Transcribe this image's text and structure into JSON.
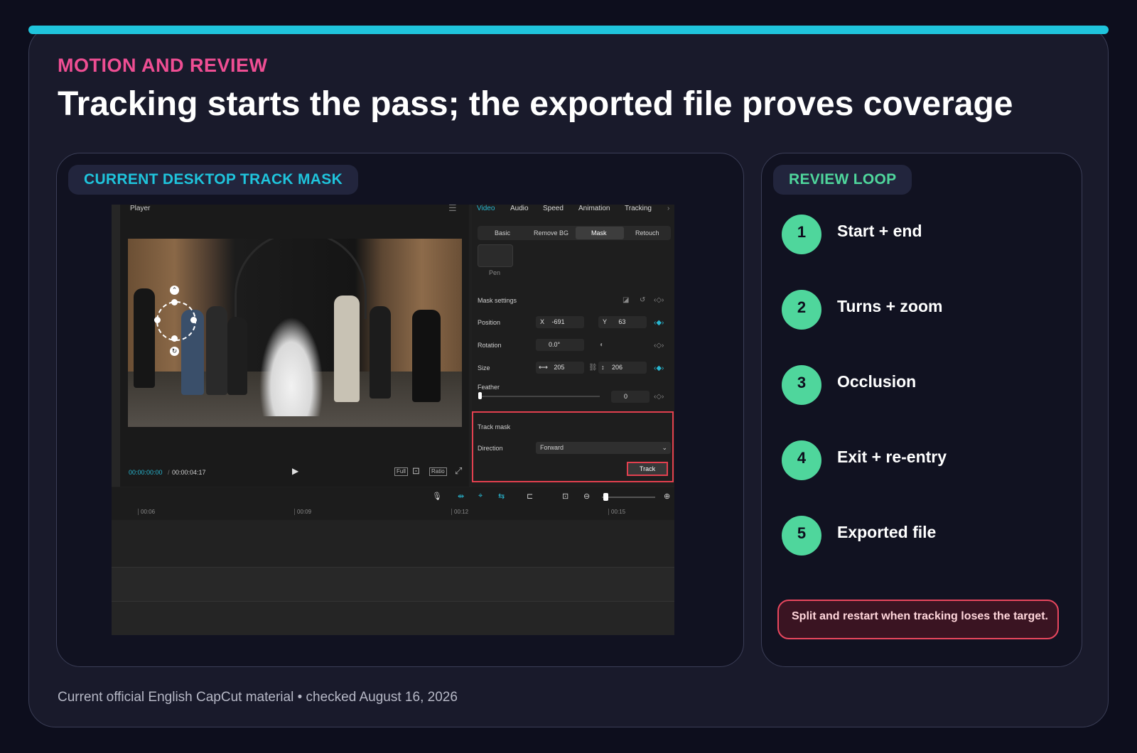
{
  "slide": {
    "eyebrow": "MOTION AND REVIEW",
    "title": "Tracking starts the pass; the exported file proves coverage",
    "footer": "Current official English CapCut material • checked August 16, 2026",
    "accent_color": "#1fc4dc",
    "eyebrow_color": "#ef4e93",
    "step_color": "#4fd69c",
    "warning_color": "#e8475e"
  },
  "left_card": {
    "label": "CURRENT DESKTOP TRACK MASK"
  },
  "capcut": {
    "player": {
      "title": "Player",
      "current_time": "00:00:00:00",
      "separator": "/",
      "total_time": "00:00:04:17",
      "controls": [
        "Full",
        "Ratio"
      ]
    },
    "panel": {
      "tabs": [
        "Video",
        "Audio",
        "Speed",
        "Animation",
        "Tracking"
      ],
      "active_tab": "Video",
      "subtabs": [
        "Basic",
        "Remove BG",
        "Mask",
        "Retouch"
      ],
      "active_subtab": "Mask",
      "pen_label": "Pen",
      "mask_settings_label": "Mask settings",
      "position": {
        "label": "Position",
        "x_label": "X",
        "x": "-691",
        "y_label": "Y",
        "y": "63"
      },
      "rotation": {
        "label": "Rotation",
        "value": "0.0°"
      },
      "size": {
        "label": "Size",
        "w": "205",
        "h": "206"
      },
      "feather": {
        "label": "Feather",
        "value": "0"
      },
      "track_mask": {
        "label": "Track mask",
        "direction_label": "Direction",
        "direction_value": "Forward",
        "track_button": "Track"
      }
    },
    "timeline": {
      "ticks": [
        "00:06",
        "00:09",
        "00:12",
        "00:15"
      ]
    }
  },
  "right_card": {
    "label": "REVIEW LOOP",
    "steps": [
      {
        "num": "1",
        "label": "Start + end"
      },
      {
        "num": "2",
        "label": "Turns + zoom"
      },
      {
        "num": "3",
        "label": "Occlusion"
      },
      {
        "num": "4",
        "label": "Exit + re-entry"
      },
      {
        "num": "5",
        "label": "Exported file"
      }
    ],
    "warning": "Split and restart when tracking loses the target."
  }
}
